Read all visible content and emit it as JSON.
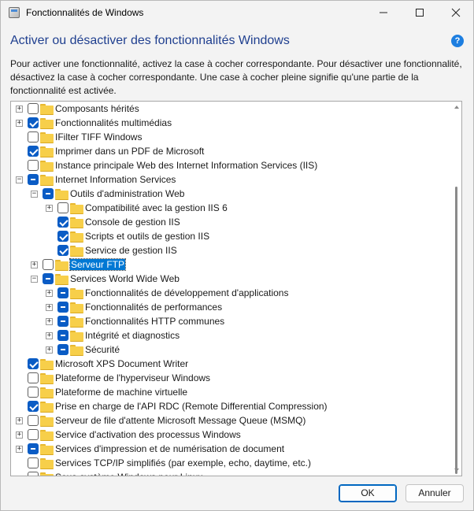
{
  "window": {
    "title": "Fonctionnalités de Windows"
  },
  "heading": "Activer ou désactiver des fonctionnalités Windows",
  "help_icon_label": "?",
  "description": "Pour activer une fonctionnalité, activez la case à cocher correspondante. Pour désactiver une fonctionnalité, désactivez la case à cocher correspondante. Une case à cocher pleine signifie qu'une partie de la fonctionnalité est activée.",
  "tree": [
    {
      "label": "Composants hérités",
      "level": 0,
      "expander": "+",
      "state": "unchecked"
    },
    {
      "label": "Fonctionnalités multimédias",
      "level": 0,
      "expander": "+",
      "state": "checked"
    },
    {
      "label": "IFilter TIFF Windows",
      "level": 0,
      "expander": "",
      "state": "unchecked"
    },
    {
      "label": "Imprimer dans un PDF de Microsoft",
      "level": 0,
      "expander": "",
      "state": "checked"
    },
    {
      "label": "Instance principale Web des Internet Information Services (IIS)",
      "level": 0,
      "expander": "",
      "state": "unchecked"
    },
    {
      "label": "Internet Information Services",
      "level": 0,
      "expander": "−",
      "state": "partial"
    },
    {
      "label": "Outils d'administration Web",
      "level": 1,
      "expander": "−",
      "state": "partial"
    },
    {
      "label": "Compatibilité avec la gestion IIS 6",
      "level": 2,
      "expander": "+",
      "state": "unchecked"
    },
    {
      "label": "Console de gestion IIS",
      "level": 2,
      "expander": "",
      "state": "checked"
    },
    {
      "label": "Scripts et outils de gestion IIS",
      "level": 2,
      "expander": "",
      "state": "checked"
    },
    {
      "label": "Service de gestion IIS",
      "level": 2,
      "expander": "",
      "state": "checked"
    },
    {
      "label": "Serveur FTP",
      "level": 1,
      "expander": "+",
      "state": "unchecked",
      "selected": true
    },
    {
      "label": "Services World Wide Web",
      "level": 1,
      "expander": "−",
      "state": "partial"
    },
    {
      "label": "Fonctionnalités de développement d'applications",
      "level": 2,
      "expander": "+",
      "state": "partial"
    },
    {
      "label": "Fonctionnalités de performances",
      "level": 2,
      "expander": "+",
      "state": "partial"
    },
    {
      "label": "Fonctionnalités HTTP communes",
      "level": 2,
      "expander": "+",
      "state": "partial"
    },
    {
      "label": "Intégrité et diagnostics",
      "level": 2,
      "expander": "+",
      "state": "partial"
    },
    {
      "label": "Sécurité",
      "level": 2,
      "expander": "+",
      "state": "partial"
    },
    {
      "label": "Microsoft XPS Document Writer",
      "level": 0,
      "expander": "",
      "state": "checked"
    },
    {
      "label": "Plateforme de l'hyperviseur Windows",
      "level": 0,
      "expander": "",
      "state": "unchecked"
    },
    {
      "label": "Plateforme de machine virtuelle",
      "level": 0,
      "expander": "",
      "state": "unchecked"
    },
    {
      "label": "Prise en charge de l'API RDC (Remote Differential Compression)",
      "level": 0,
      "expander": "",
      "state": "checked"
    },
    {
      "label": "Serveur de file d'attente Microsoft Message Queue (MSMQ)",
      "level": 0,
      "expander": "+",
      "state": "unchecked"
    },
    {
      "label": "Service d'activation des processus Windows",
      "level": 0,
      "expander": "+",
      "state": "unchecked"
    },
    {
      "label": "Services d'impression et de numérisation de document",
      "level": 0,
      "expander": "+",
      "state": "partial"
    },
    {
      "label": "Services TCP/IP simplifiés (par exemple, echo, daytime, etc.)",
      "level": 0,
      "expander": "",
      "state": "unchecked"
    },
    {
      "label": "Sous-système Windows pour Linux",
      "level": 0,
      "expander": "",
      "state": "unchecked"
    }
  ],
  "buttons": {
    "ok": "OK",
    "cancel": "Annuler"
  },
  "colors": {
    "accent": "#0a5cc5",
    "heading": "#1f3f8f",
    "selection": "#0078d4",
    "folder": "#f7cf4a"
  }
}
